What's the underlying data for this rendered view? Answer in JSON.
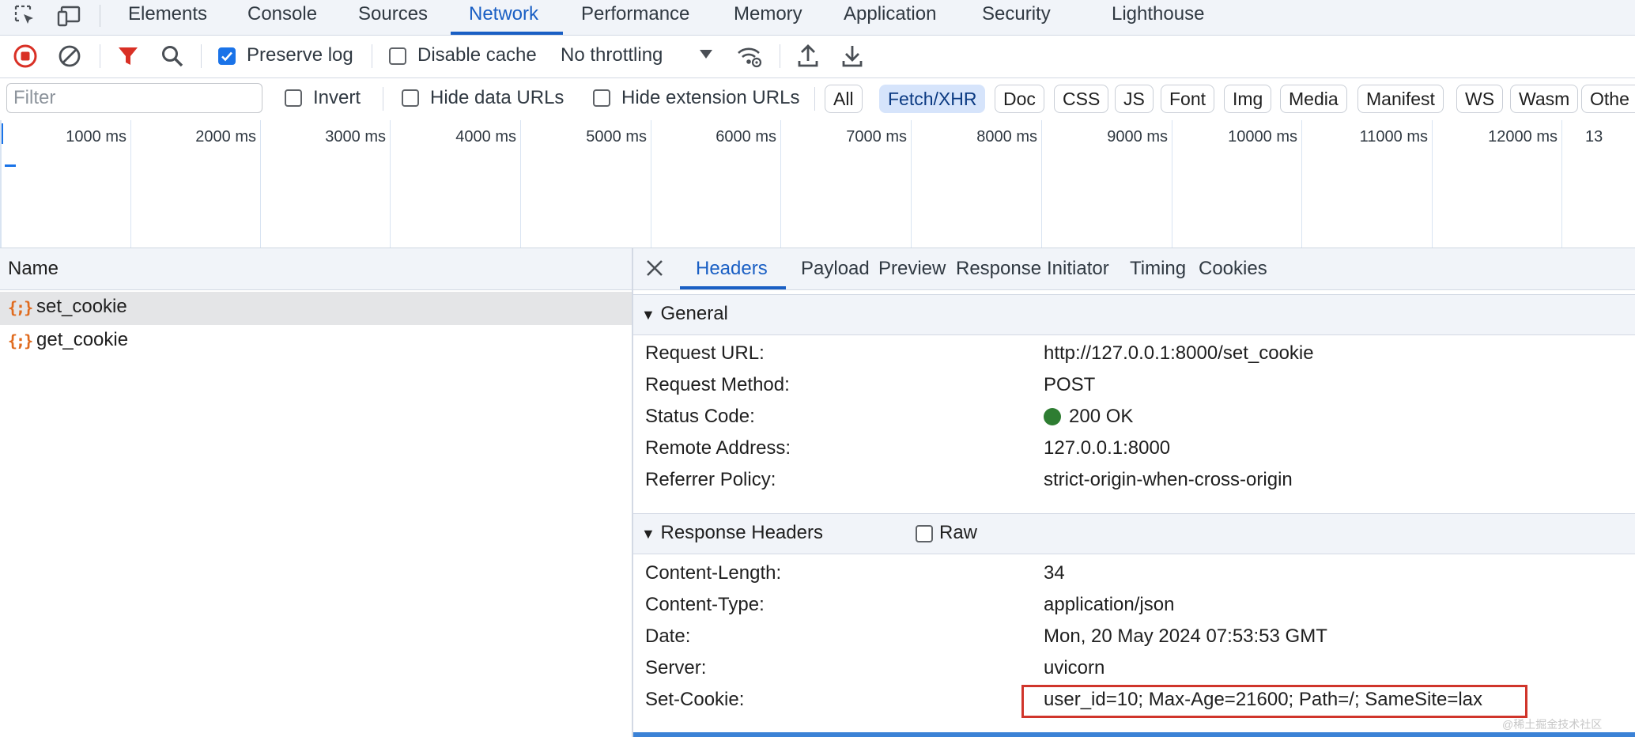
{
  "tabs": [
    "Elements",
    "Console",
    "Sources",
    "Network",
    "Performance",
    "Memory",
    "Application",
    "Security",
    "Lighthouse"
  ],
  "active_tab": "Network",
  "toolbar": {
    "preserve_log_label": "Preserve log",
    "preserve_log_checked": true,
    "disable_cache_label": "Disable cache",
    "disable_cache_checked": false,
    "throttling": "No throttling"
  },
  "filter": {
    "placeholder": "Filter",
    "invert_label": "Invert",
    "hide_data_urls_label": "Hide data URLs",
    "hide_extension_urls_label": "Hide extension URLs",
    "types": [
      "All",
      "Fetch/XHR",
      "Doc",
      "CSS",
      "JS",
      "Font",
      "Img",
      "Media",
      "Manifest",
      "WS",
      "Wasm",
      "Othe"
    ],
    "active_type": "Fetch/XHR"
  },
  "timeline": {
    "ticks": [
      "1000 ms",
      "2000 ms",
      "3000 ms",
      "4000 ms",
      "5000 ms",
      "6000 ms",
      "7000 ms",
      "8000 ms",
      "9000 ms",
      "10000 ms",
      "11000 ms",
      "12000 ms",
      "13"
    ]
  },
  "requests": {
    "header": "Name",
    "items": [
      {
        "icon": "{;}",
        "name": "set_cookie",
        "selected": true
      },
      {
        "icon": "{;}",
        "name": "get_cookie",
        "selected": false
      }
    ]
  },
  "detail": {
    "tabs": [
      "Headers",
      "Payload",
      "Preview",
      "Response",
      "Initiator",
      "Timing",
      "Cookies"
    ],
    "active_tab": "Headers",
    "general": {
      "title": "General",
      "rows": [
        {
          "key": "Request URL:",
          "value": "http://127.0.0.1:8000/set_cookie"
        },
        {
          "key": "Request Method:",
          "value": "POST"
        },
        {
          "key": "Status Code:",
          "value": "200 OK"
        },
        {
          "key": "Remote Address:",
          "value": "127.0.0.1:8000"
        },
        {
          "key": "Referrer Policy:",
          "value": "strict-origin-when-cross-origin"
        }
      ]
    },
    "response_headers": {
      "title": "Response Headers",
      "raw_label": "Raw",
      "rows": [
        {
          "key": "Content-Length:",
          "value": "34"
        },
        {
          "key": "Content-Type:",
          "value": "application/json"
        },
        {
          "key": "Date:",
          "value": "Mon, 20 May 2024 07:53:53 GMT"
        },
        {
          "key": "Server:",
          "value": "uvicorn"
        },
        {
          "key": "Set-Cookie:",
          "value": "user_id=10; Max-Age=21600; Path=/; SameSite=lax"
        }
      ]
    }
  },
  "colors": {
    "accent": "#1a5fc4",
    "status_ok": "#2e7d32",
    "highlight": "#d0352b",
    "record": "#d93025"
  },
  "watermark": "@稀土掘金技术社区"
}
